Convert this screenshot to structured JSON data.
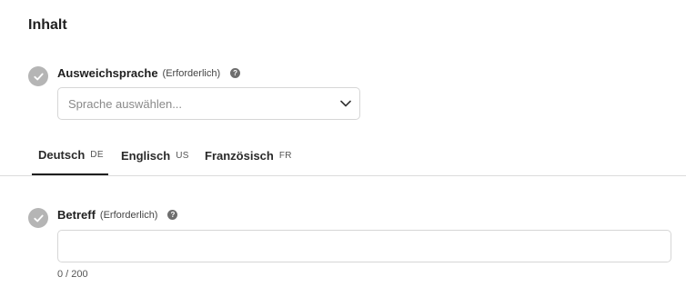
{
  "section": {
    "title": "Inhalt"
  },
  "fallback_language": {
    "label": "Ausweichsprache",
    "required": "(Erforderlich)",
    "help": "?",
    "select_placeholder": "Sprache auswählen..."
  },
  "tabs": [
    {
      "name": "Deutsch",
      "code": "DE",
      "active": true
    },
    {
      "name": "Englisch",
      "code": "US",
      "active": false
    },
    {
      "name": "Französisch",
      "code": "FR",
      "active": false
    }
  ],
  "subject": {
    "label": "Betreff",
    "required": "(Erforderlich)",
    "help": "?",
    "value": "",
    "counter": "0 / 200"
  },
  "colors": {
    "check_bg": "#b5b5b5",
    "active_tab_underline": "#1f1f1f",
    "border": "#d6d6d6"
  }
}
